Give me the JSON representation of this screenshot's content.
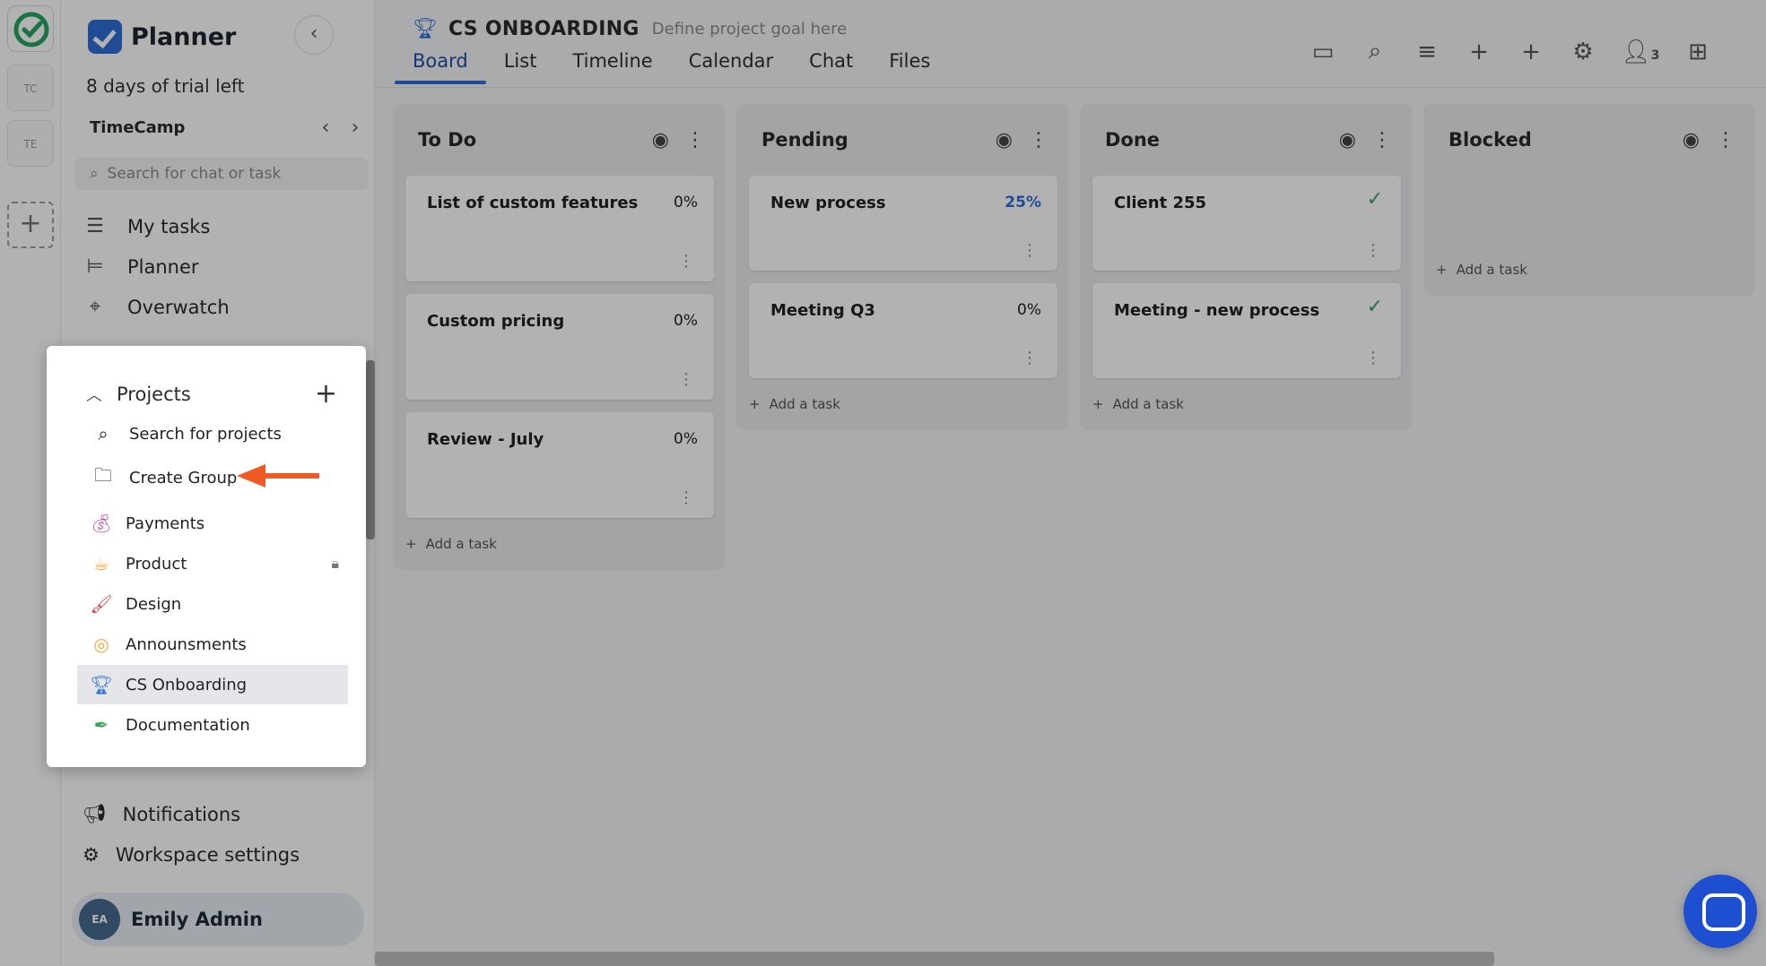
{
  "rail": {
    "workspaces": [
      "TC",
      "TE"
    ],
    "add_label": "+"
  },
  "sidebar": {
    "brand": "Planner",
    "trial": "8 days of trial left",
    "workspace": "TimeCamp",
    "search_placeholder": "Search for chat or task",
    "nav": [
      {
        "label": "My tasks",
        "icon": "list-check-icon"
      },
      {
        "label": "Planner",
        "icon": "gantt-icon"
      },
      {
        "label": "Overwatch",
        "icon": "telescope-icon"
      }
    ],
    "notifications": "Notifications",
    "workspace_settings": "Workspace settings",
    "user": {
      "initials": "EA",
      "name": "Emily Admin"
    }
  },
  "header": {
    "project_name": "CS ONBOARDING",
    "goal_placeholder": "Define project goal here",
    "tabs": [
      "Board",
      "List",
      "Timeline",
      "Calendar",
      "Chat",
      "Files"
    ],
    "active_tab": "Board",
    "member_count": "3"
  },
  "board": {
    "add_task_label": "Add a task",
    "columns": [
      {
        "title": "To Do",
        "cards": [
          {
            "title": "List of custom features",
            "progress": "0%"
          },
          {
            "title": "Custom pricing",
            "progress": "0%"
          },
          {
            "title": "Review - July",
            "progress": "0%"
          }
        ]
      },
      {
        "title": "Pending",
        "cards": [
          {
            "title": "New process",
            "progress": "25%"
          },
          {
            "title": "Meeting Q3",
            "progress": "0%"
          }
        ]
      },
      {
        "title": "Done",
        "cards": [
          {
            "title": "Client 255",
            "done": true
          },
          {
            "title": "Meeting - new process",
            "done": true
          }
        ]
      },
      {
        "title": "Blocked",
        "cards": []
      }
    ]
  },
  "projects_popup": {
    "title": "Projects",
    "search_label": "Search for projects",
    "create_group_label": "Create Group",
    "items": [
      {
        "label": "Payments",
        "icon": "money-bag-icon",
        "color": "#c04ca8"
      },
      {
        "label": "Product",
        "icon": "coffee-icon",
        "color": "#f2a93b",
        "locked": true
      },
      {
        "label": "Design",
        "icon": "brush-icon",
        "color": "#d94040"
      },
      {
        "label": "Announsments",
        "icon": "target-icon",
        "color": "#f2a93b"
      },
      {
        "label": "CS Onboarding",
        "icon": "trophy-icon",
        "color": "#2e6ed6",
        "selected": true
      },
      {
        "label": "Documentation",
        "icon": "pen-icon",
        "color": "#3aa55a"
      }
    ]
  },
  "colors": {
    "accent": "#2e6ed6",
    "done": "#3aa55a",
    "arrow": "#f15a24",
    "chat": "#1f4fd1"
  }
}
